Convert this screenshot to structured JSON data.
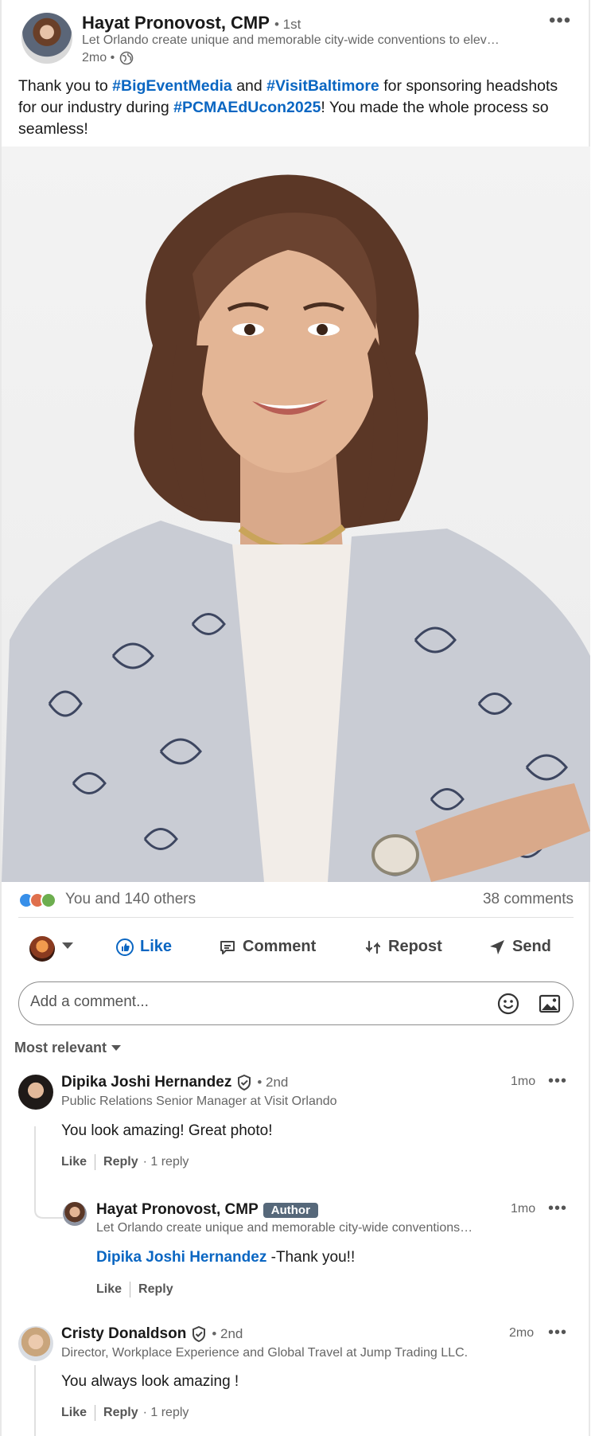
{
  "post": {
    "author_name": "Hayat Pronovost, CMP",
    "author_degree": "• 1st",
    "author_headline": "Let Orlando create unique and memorable city-wide conventions to elev…",
    "time": "2mo •",
    "text_1": "Thank you to ",
    "hashtag_1": "#BigEventMedia",
    "text_2": " and ",
    "hashtag_2": "#VisitBaltimore",
    "text_3": " for sponsoring headshots for our industry during ",
    "hashtag_3": "#PCMAEdUcon2025",
    "text_4": "! You made the whole process so seamless!"
  },
  "social": {
    "reactions_text": "You and 140 others",
    "comments_count": "38 comments",
    "reaction_icons": [
      "like-icon",
      "love-icon",
      "celebrate-icon"
    ]
  },
  "actions": {
    "like": "Like",
    "comment": "Comment",
    "repost": "Repost",
    "send": "Send"
  },
  "comment_box": {
    "placeholder": "Add a comment..."
  },
  "sort": {
    "label": "Most relevant"
  },
  "comments": [
    {
      "name": "Dipika Joshi Hernandez",
      "degree": "• 2nd",
      "headline": "Public Relations Senior Manager at Visit Orlando",
      "time": "1mo",
      "body": "You look amazing! Great photo!",
      "like": "Like",
      "reply": "Reply",
      "replies": "· 1 reply"
    },
    {
      "name": "Hayat Pronovost, CMP",
      "badge": "Author",
      "headline": "Let Orlando create unique and memorable city-wide conventions…",
      "time": "1mo",
      "mention": "Dipika Joshi Hernandez",
      "body": " -Thank you!!",
      "like": "Like",
      "reply": "Reply"
    },
    {
      "name": "Cristy Donaldson",
      "degree": "• 2nd",
      "headline": "Director, Workplace Experience and Global Travel at Jump Trading LLC.",
      "time": "2mo",
      "body": "You always look amazing !",
      "like": "Like",
      "reply": "Reply",
      "replies": "· 1 reply"
    }
  ],
  "colors": {
    "link": "#0a66c2",
    "author_badge": "#56687a"
  }
}
